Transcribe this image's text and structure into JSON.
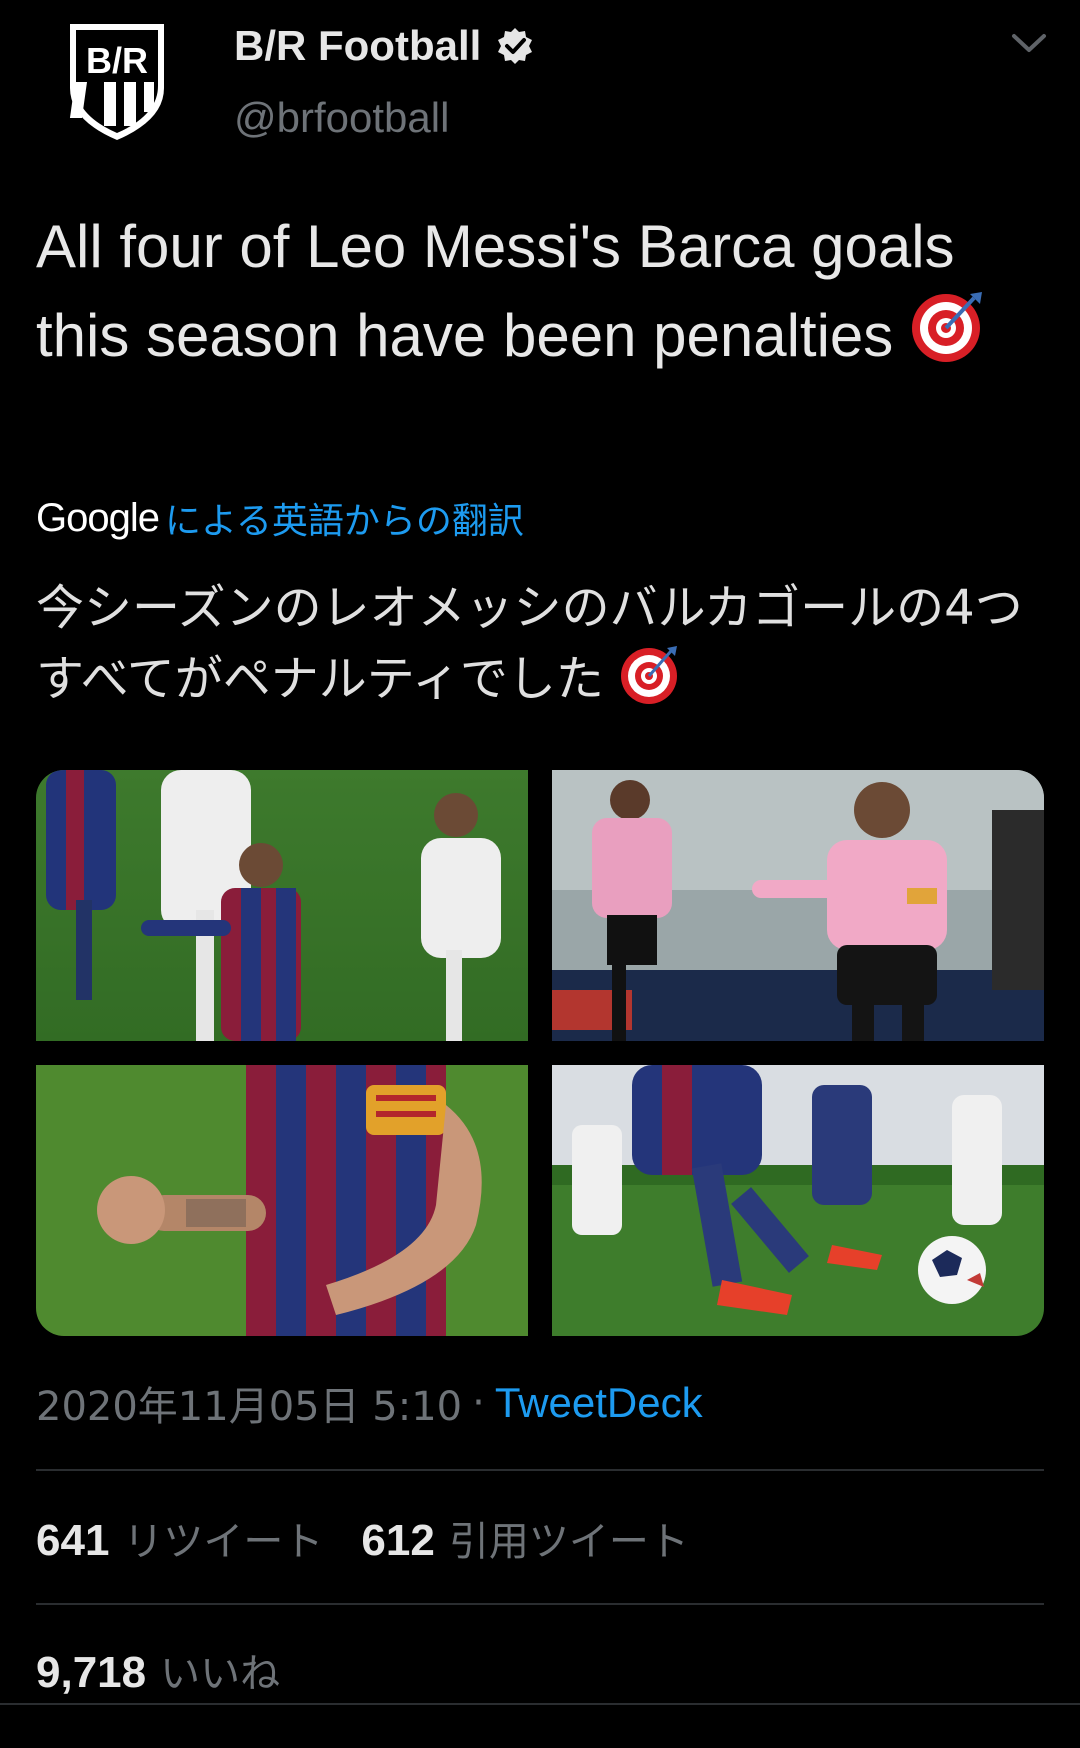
{
  "author": {
    "display_name": "B/R Football",
    "handle": "@brfootball",
    "avatar_icon": "br-shield-logo",
    "avatar_text": "B/R",
    "verified_icon": "verified-badge-icon"
  },
  "menu": {
    "icon": "chevron-down-icon"
  },
  "tweet": {
    "text": "All four of Leo Messi's Barca goals this season have been penalties",
    "emoji": "target-emoji"
  },
  "translation": {
    "provider": "Google",
    "link_text": "による英語からの翻訳",
    "text": "今シーズンのレオメッシのバルカゴールの4つすべてがペナルティでした"
  },
  "media": [
    {
      "name": "photo-messi-penalty-home",
      "icon": "photo"
    },
    {
      "name": "photo-messi-pink-kit",
      "icon": "photo"
    },
    {
      "name": "photo-messi-fist-celebration",
      "icon": "photo"
    },
    {
      "name": "photo-messi-ball-kick",
      "icon": "photo"
    }
  ],
  "meta": {
    "timestamp": "2020年11月05日 5:10",
    "separator": "·",
    "source": "TweetDeck"
  },
  "stats": {
    "retweets_count": "641",
    "retweets_label": "リツイート",
    "quotes_count": "612",
    "quotes_label": "引用ツイート",
    "likes_count": "9,718",
    "likes_label": "いいね"
  },
  "colors": {
    "background": "#000000",
    "accent": "#1d9bf0",
    "muted": "#6e7378",
    "text": "#e8e8e8"
  }
}
